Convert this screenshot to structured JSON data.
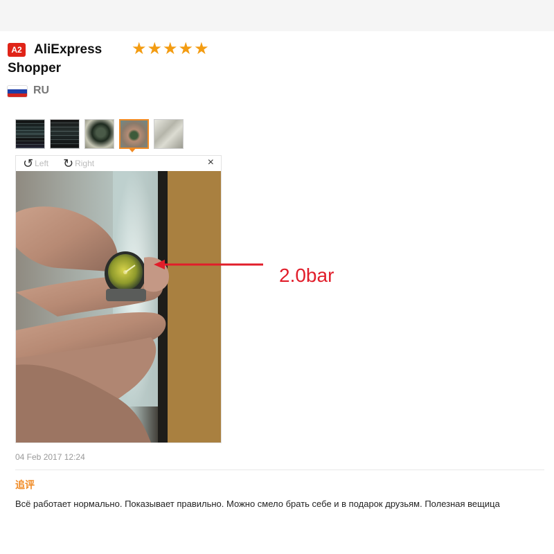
{
  "header": {
    "avatar_text": "A2",
    "user_name": "AliExpress Shopper",
    "rating_stars": 5,
    "stars_text": "★★★★★",
    "country": "RU",
    "flag_colors": [
      "#ffffff",
      "#1c3ea8",
      "#d0241f"
    ]
  },
  "thumbnails": [
    {
      "name": "photo-1",
      "active": false
    },
    {
      "name": "photo-2",
      "active": false
    },
    {
      "name": "photo-3",
      "active": false
    },
    {
      "name": "photo-4",
      "active": true
    },
    {
      "name": "photo-5",
      "active": false
    }
  ],
  "viewer": {
    "rotate_left_label": "Left",
    "rotate_right_label": "Right",
    "close_symbol": "×",
    "annotation": "2.0bar",
    "annotation_color": "#e11d2a"
  },
  "review": {
    "date": "04 Feb 2017 12:24",
    "feedback_label": "追评",
    "feedback_text": "Всё работает нормально. Показывает правильно. Можно смело брать себе и в подарок друзьям. Полезная вещица"
  },
  "colors": {
    "accent": "#f08a24",
    "badge": "#e02418",
    "star": "#f39c12"
  }
}
